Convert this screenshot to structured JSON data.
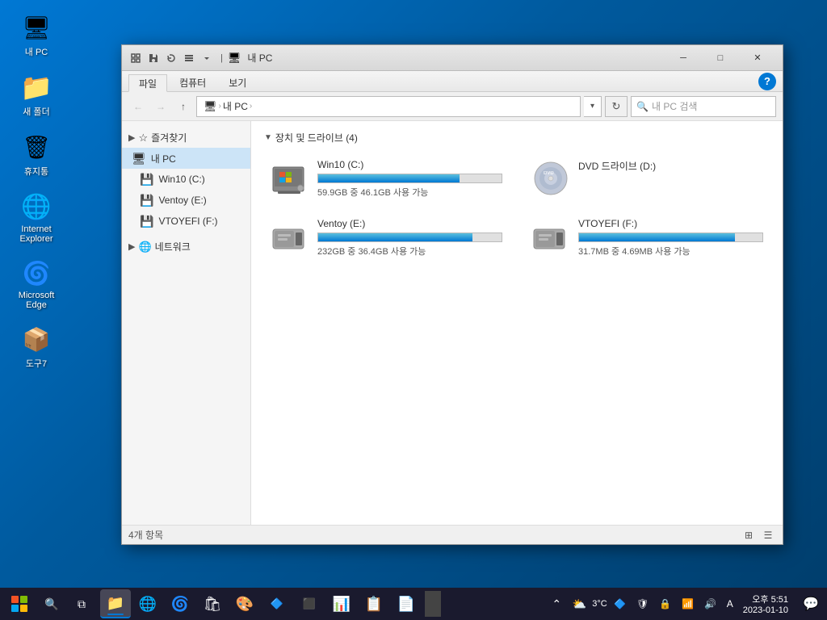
{
  "desktop": {
    "icons": [
      {
        "id": "my-pc",
        "label": "내 PC",
        "emoji": "🖥"
      },
      {
        "id": "new-folder",
        "label": "새 폴더",
        "emoji": "📁"
      },
      {
        "id": "recycle-bin",
        "label": "휴지통",
        "emoji": "🗑"
      },
      {
        "id": "internet-explorer",
        "label": "Internet Explorer",
        "emoji": "🌐"
      },
      {
        "id": "microsoft-edge",
        "label": "Microsoft Edge",
        "emoji": "🌀"
      },
      {
        "id": "tools7",
        "label": "도구7",
        "emoji": "📦"
      }
    ]
  },
  "window": {
    "title": "내 PC",
    "tabs": [
      "파일",
      "컴퓨터",
      "보기"
    ],
    "active_tab": "파일",
    "breadcrumb": [
      "내 PC"
    ],
    "status": "4개 항목"
  },
  "sidebar": {
    "quick_access_label": "즐겨찾기",
    "my_pc_label": "내 PC",
    "items": [
      {
        "id": "my-pc",
        "label": "내 PC",
        "active": true
      },
      {
        "id": "win10-c",
        "label": "Win10 (C:)"
      },
      {
        "id": "ventoy-e",
        "label": "Ventoy (E:)"
      },
      {
        "id": "vtoyefi-f",
        "label": "VTOYEFI (F:)"
      }
    ],
    "network_label": "네트워크"
  },
  "drives": {
    "section_title": "장치 및 드라이브 (4)",
    "items": [
      {
        "id": "win10-c",
        "name": "Win10 (C:)",
        "type": "hdd",
        "used_pct": 77,
        "space_text": "59.9GB 중 46.1GB 사용 가능",
        "warning": false
      },
      {
        "id": "dvd-d",
        "name": "DVD 드라이브 (D:)",
        "type": "dvd",
        "used_pct": 0,
        "space_text": "",
        "warning": false
      },
      {
        "id": "ventoy-e",
        "name": "Ventoy (E:)",
        "type": "usb",
        "used_pct": 84,
        "space_text": "232GB 중 36.4GB 사용 가능",
        "warning": false
      },
      {
        "id": "vtoyefi-f",
        "name": "VTOYEFI (F:)",
        "type": "usb",
        "used_pct": 85,
        "space_text": "31.7MB 중 4.69MB 사용 가능",
        "warning": false
      }
    ]
  },
  "taskbar": {
    "apps": [
      {
        "id": "file-explorer",
        "emoji": "📁",
        "active": true
      },
      {
        "id": "ie",
        "emoji": "🌐"
      },
      {
        "id": "edge",
        "emoji": "🌀"
      },
      {
        "id": "store",
        "emoji": "🛍"
      },
      {
        "id": "paint",
        "emoji": "🎨"
      },
      {
        "id": "powershell",
        "emoji": "⬛"
      },
      {
        "id": "terminal",
        "emoji": "⬛"
      },
      {
        "id": "excel",
        "emoji": "📊"
      },
      {
        "id": "powerpoint",
        "emoji": "📋"
      },
      {
        "id": "pdf",
        "emoji": "📄"
      }
    ],
    "systray": {
      "weather": "3°C",
      "lang": "A",
      "time": "오후 5:51",
      "date": "2023-01-10"
    }
  },
  "labels": {
    "minimize": "─",
    "maximize": "□",
    "close": "✕",
    "back": "←",
    "forward": "→",
    "up": "↑",
    "refresh": "↻",
    "search_placeholder": "내 PC 검색",
    "help": "?"
  }
}
